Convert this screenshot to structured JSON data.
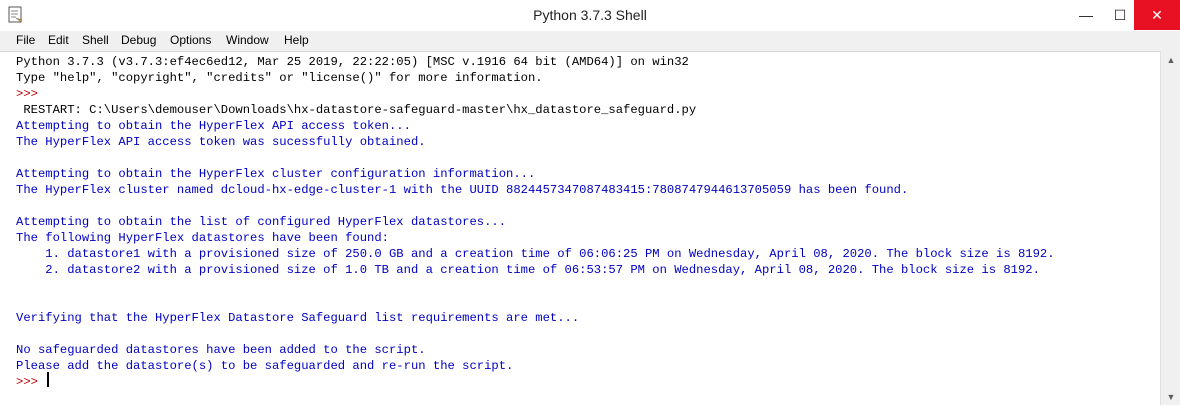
{
  "window": {
    "title": "Python 3.7.3 Shell",
    "controls": {
      "minimize": "—",
      "maximize": "☐",
      "close": "✕"
    }
  },
  "menu": [
    "File",
    "Edit",
    "Shell",
    "Debug",
    "Options",
    "Window",
    "Help"
  ],
  "lines": [
    {
      "text": "Python 3.7.3 (v3.7.3:ef4ec6ed12, Mar 25 2019, 22:22:05) [MSC v.1916 64 bit (AMD64)] on win32",
      "style": "out"
    },
    {
      "text": "Type \"help\", \"copyright\", \"credits\" or \"license()\" for more information.",
      "style": "out"
    },
    {
      "text": ">>> ",
      "style": "prompt"
    },
    {
      "text": " RESTART: C:\\Users\\demouser\\Downloads\\hx-datastore-safeguard-master\\hx_datastore_safeguard.py",
      "style": "out"
    },
    {
      "text": "Attempting to obtain the HyperFlex API access token...",
      "style": "blue"
    },
    {
      "text": "The HyperFlex API access token was sucessfully obtained.",
      "style": "blue"
    },
    {
      "text": "",
      "style": "blue"
    },
    {
      "text": "Attempting to obtain the HyperFlex cluster configuration information...",
      "style": "blue"
    },
    {
      "text": "The HyperFlex cluster named dcloud-hx-edge-cluster-1 with the UUID 8824457347087483415:7808747944613705059 has been found.",
      "style": "blue"
    },
    {
      "text": "",
      "style": "blue"
    },
    {
      "text": "Attempting to obtain the list of configured HyperFlex datastores...",
      "style": "blue"
    },
    {
      "text": "The following HyperFlex datastores have been found:",
      "style": "blue"
    },
    {
      "text": "    1. datastore1 with a provisioned size of 250.0 GB and a creation time of 06:06:25 PM on Wednesday, April 08, 2020. The block size is 8192.",
      "style": "blue"
    },
    {
      "text": "    2. datastore2 with a provisioned size of 1.0 TB and a creation time of 06:53:57 PM on Wednesday, April 08, 2020. The block size is 8192.",
      "style": "blue"
    },
    {
      "text": "",
      "style": "blue"
    },
    {
      "text": "",
      "style": "blue"
    },
    {
      "text": "Verifying that the HyperFlex Datastore Safeguard list requirements are met...",
      "style": "blue"
    },
    {
      "text": "",
      "style": "blue"
    },
    {
      "text": "No safeguarded datastores have been added to the script.",
      "style": "blue"
    },
    {
      "text": "Please add the datastore(s) to be safeguarded and re-run the script.",
      "style": "blue"
    },
    {
      "text": ">>> ",
      "style": "prompt"
    }
  ],
  "scrollbar": {
    "up": "▲",
    "down": "▼"
  }
}
